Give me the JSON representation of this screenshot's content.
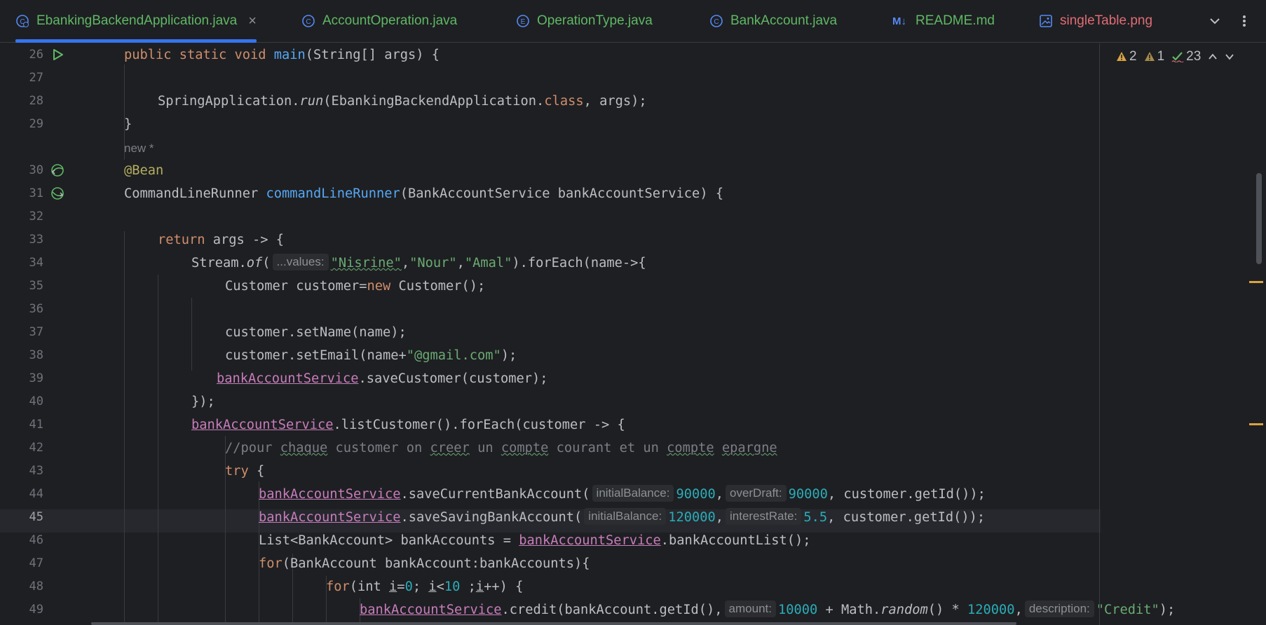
{
  "tabs": [
    {
      "label": "EbankingBackendApplication.java",
      "icon": "class-run-icon",
      "active": true
    },
    {
      "label": "AccountOperation.java",
      "icon": "class-icon"
    },
    {
      "label": "OperationType.java",
      "icon": "enum-icon"
    },
    {
      "label": "BankAccount.java",
      "icon": "class-icon"
    },
    {
      "label": "README.md",
      "icon": "markdown-icon",
      "icon_text": "M↓"
    },
    {
      "label": "singleTable.png",
      "icon": "image-icon"
    }
  ],
  "inspections": {
    "warnings": "2",
    "weak_warnings": "1",
    "typos": "23"
  },
  "line_numbers": [
    "26",
    "27",
    "28",
    "29",
    "30",
    "31",
    "32",
    "33",
    "34",
    "35",
    "36",
    "37",
    "38",
    "39",
    "40",
    "41",
    "42",
    "43",
    "44",
    "45",
    "46",
    "47",
    "48",
    "49"
  ],
  "current_line": "45",
  "new_hint": "new *",
  "code": {
    "l26": {
      "kw1": "public static void",
      "fn": "main",
      "rest": "(String[] args) {"
    },
    "l28": {
      "a": "SpringApplication.",
      "run": "run",
      "b": "(EbankingBackendApplication.",
      "cls": "class",
      "c": ", args);"
    },
    "l29": "}",
    "l30": "@Bean",
    "l31": {
      "a": "CommandLineRunner ",
      "fn": "commandLineRunner",
      "b": "(BankAccountService bankAccountService) {"
    },
    "l33": {
      "kw": "return",
      "rest": " args -> {"
    },
    "l34": {
      "a": "Stream.",
      "of": "of",
      "b": "(",
      "hint": "...values:",
      "s1": "\"Nisrine\"",
      "c1": ",",
      "s2": "\"Nour\"",
      "c2": ",",
      "s3": "\"Amal\"",
      "d": ").forEach(name->{"
    },
    "l35": {
      "a": "Customer customer=",
      "kw": "new",
      "b": " Customer();"
    },
    "l37": "customer.setName(name);",
    "l38": {
      "a": "customer.setEmail(name+",
      "s": "\"@gmail.com\"",
      "b": ");"
    },
    "l39": {
      "fld": "bankAccountService",
      "rest": ".saveCustomer(customer);"
    },
    "l40": "});",
    "l41": {
      "fld": "bankAccountService",
      "rest": ".listCustomer().forEach(customer -> {"
    },
    "l42": {
      "c1": "//pour ",
      "w1": "chaque",
      "c2": " customer on ",
      "w2": "creer",
      "c3": " un ",
      "w3": "compte",
      "c4": " courant et un ",
      "w4": "compte",
      "c5": " ",
      "w5": "epargne"
    },
    "l43": {
      "kw": "try",
      "rest": " {"
    },
    "l44": {
      "fld": "bankAccountService",
      "a": ".saveCurrentBankAccount(",
      "h1": "initialBalance:",
      "n1": "90000",
      "b": ",",
      "h2": "overDraft:",
      "n2": "90000",
      "c": ", customer.getId());"
    },
    "l45": {
      "fld": "bankAccountService",
      "a": ".saveSavingBankAccount(",
      "h1": "initialBalance:",
      "n1": "120000",
      "b": ",",
      "h2": "interestRate:",
      "n2": "5.5",
      "c": ", customer.getId());"
    },
    "l46": {
      "a": "List<BankAccount> bankAccounts = ",
      "fld": "bankAccountService",
      "b": ".bankAccountList();"
    },
    "l47": {
      "kw": "for",
      "rest": "(BankAccount bankAccount:bankAccounts){"
    },
    "l48": {
      "kw": "for",
      "a": "(int ",
      "i1": "i",
      "b": "=",
      "n0": "0",
      "c": "; ",
      "i2": "i",
      "d": "<",
      "n10": "10",
      "e": " ;",
      "i3": "i",
      "f": "++) {"
    },
    "l49": {
      "fld": "bankAccountService",
      "a": ".credit(bankAccount.getId(),",
      "h1": "amount:",
      "n1": "10000",
      "b": " + Math.",
      "rnd": "random",
      "c": "() * ",
      "n2": "120000",
      "d": ",",
      "h2": "description:",
      "s": "\"Credit\"",
      "e": ");"
    }
  },
  "colors": {
    "background": "#1e1f22",
    "keyword": "#cf8e6d",
    "function": "#56a8f5",
    "string": "#6aab73",
    "number": "#2aacb8",
    "field": "#c77dbb",
    "accent": "#3574f0"
  }
}
